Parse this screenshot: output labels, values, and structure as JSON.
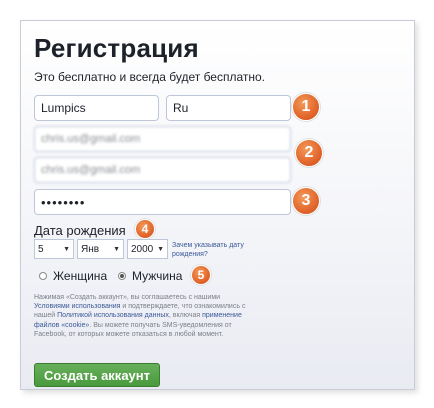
{
  "form": {
    "title": "Регистрация",
    "subtitle": "Это бесплатно и всегда будет бесплатно.",
    "first_name": "Lumpics",
    "last_name": "Ru",
    "email": "chris.us@gmail.com",
    "email_confirm": "chris.us@gmail.com",
    "password": "••••••••",
    "dob_label": "Дата рождения",
    "dob_day": "5",
    "dob_month": "Янв",
    "dob_year": "2000",
    "why_dob": "Зачем указывать дату рождения?",
    "gender_female": "Женщина",
    "gender_male": "Мужчина",
    "selected_gender": "male",
    "terms_line1": "Нажимая «Создать аккаунт», вы соглашаетесь с нашими",
    "terms_link1": "Условиями использования",
    "terms_line2": " и подтверждаете, что ознакомились с нашей ",
    "terms_link2": "Политикой использования данных",
    "terms_line3": ", включая ",
    "terms_link3": "применение файлов «cookie»",
    "terms_line4": ". Вы можете получать SMS-уведомления от Facebook, от которых можете отказаться в любой момент.",
    "create_label": "Создать аккаунт"
  },
  "badges": [
    "1",
    "2",
    "3",
    "4",
    "5"
  ],
  "colors": {
    "badge": "#e2662c",
    "button": "#4a9a3e",
    "link": "#3b5998"
  }
}
